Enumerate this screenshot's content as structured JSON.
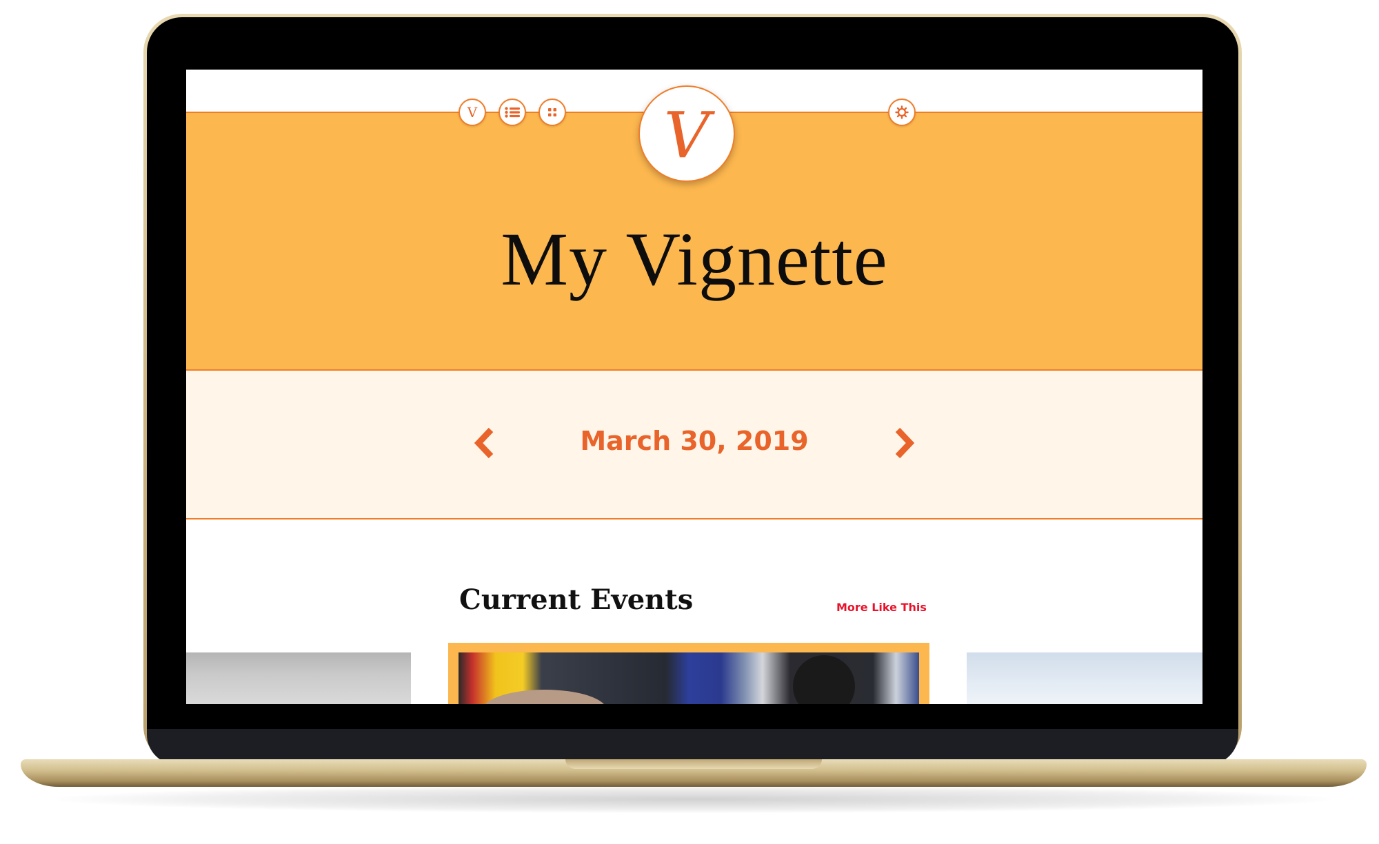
{
  "app": {
    "title": "My Vignette",
    "logo_letter": "V"
  },
  "header": {
    "nav_icons": [
      "vignette-icon",
      "list-icon",
      "grid-icon",
      "gear-icon"
    ],
    "nav_v_letter": "V"
  },
  "date_nav": {
    "date": "March 30, 2019",
    "prev_icon": "chevron-left-icon",
    "next_icon": "chevron-right-icon"
  },
  "section": {
    "title": "Current Events",
    "more_link": "More Like This"
  },
  "colors": {
    "accent": "#e8642a",
    "hero_bg": "#fdb74f",
    "datebar_bg": "#fff6e9",
    "link_red": "#e8122a"
  }
}
